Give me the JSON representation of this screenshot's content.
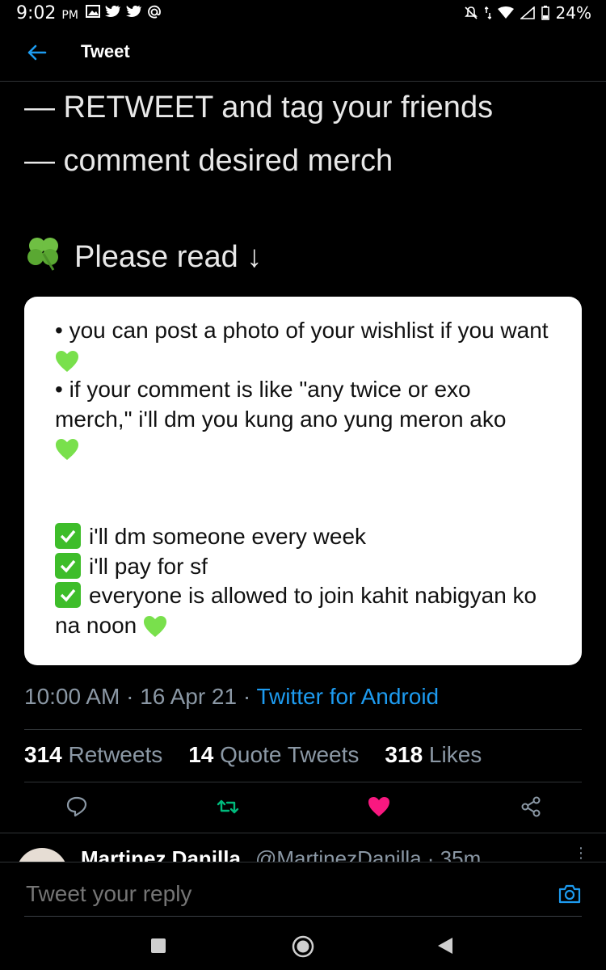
{
  "status_bar": {
    "time": "9:02",
    "ampm": "PM",
    "battery": "24%"
  },
  "app_bar": {
    "title": "Tweet"
  },
  "tweet": {
    "lines": [
      "— RETWEET and tag your friends",
      "— comment desired merch"
    ],
    "please_read": "Please read ↓",
    "card": {
      "bullet1": "• you can post a photo of your wishlist if you want",
      "bullet2": "• if your comment is like \"any twice or exo merch,\" i'll dm you kung ano yung meron ako",
      "checks": [
        "i'll dm someone every week",
        "i'll pay for sf",
        "everyone is allowed to join kahit nabigyan ko na noon"
      ]
    },
    "time": "10:00 AM",
    "date": "16 Apr 21",
    "source": "Twitter for Android"
  },
  "stats": {
    "retweets": {
      "count": "314",
      "label": "Retweets"
    },
    "quotes": {
      "count": "14",
      "label": "Quote Tweets"
    },
    "likes": {
      "count": "318",
      "label": "Likes"
    }
  },
  "colors": {
    "accent": "#1d9bf0",
    "like": "#f91880",
    "retweet": "#00ba7c",
    "check": "#3ebd2a",
    "green_heart": "#79e04c"
  },
  "reply_preview": {
    "name": "Martinez Danilla",
    "handle": "@MartinezDanilla · 35m"
  },
  "reply_bar": {
    "placeholder": "Tweet your reply"
  }
}
